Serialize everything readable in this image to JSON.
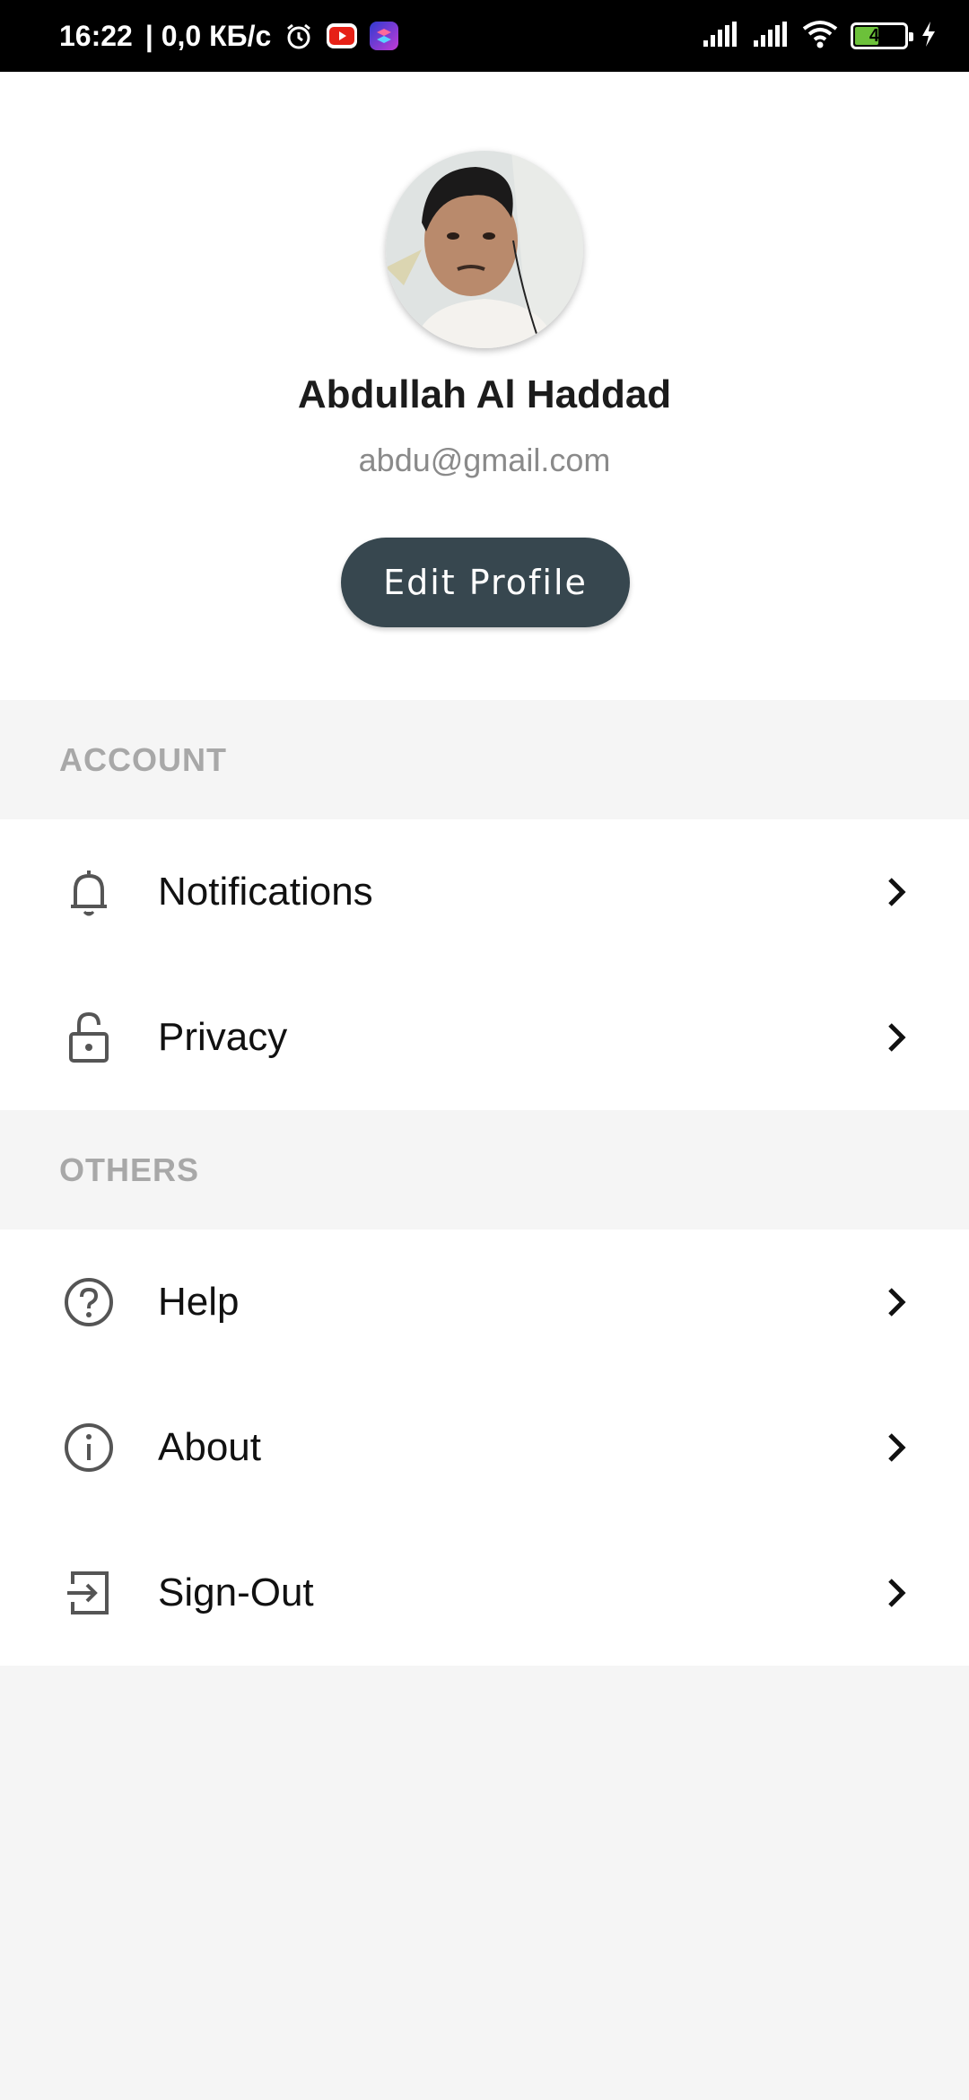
{
  "status_bar": {
    "time": "16:22",
    "network_speed": "| 0,0 КБ/с",
    "battery": "49",
    "icons": [
      "alarm-icon",
      "youtube-icon",
      "shortcuts-icon",
      "signal-icon",
      "signal-icon",
      "wifi-icon",
      "battery-icon",
      "charging-icon"
    ]
  },
  "profile": {
    "name": "Abdullah Al Haddad",
    "email": "abdu@gmail.com",
    "edit_button_label": "Edit Profile"
  },
  "sections": {
    "account": {
      "title": "ACCOUNT",
      "items": [
        {
          "label": "Notifications",
          "icon": "bell-icon"
        },
        {
          "label": "Privacy",
          "icon": "lock-icon"
        }
      ]
    },
    "others": {
      "title": "OTHERS",
      "items": [
        {
          "label": "Help",
          "icon": "help-icon"
        },
        {
          "label": "About",
          "icon": "info-icon"
        },
        {
          "label": "Sign-Out",
          "icon": "sign-out-icon"
        }
      ]
    }
  },
  "colors": {
    "button_bg": "#37474f",
    "section_bg": "#f5f5f5",
    "section_title": "#a8a8a8",
    "battery_fill": "#6cc13a"
  }
}
